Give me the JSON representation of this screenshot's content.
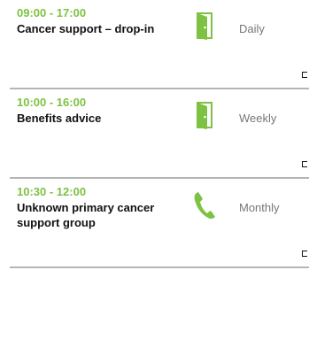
{
  "items": [
    {
      "time": "09:00 - 17:00",
      "title": "Cancer support – drop-in",
      "frequency": "Daily",
      "icon": "door-icon"
    },
    {
      "time": "10:00 - 16:00",
      "title": "Benefits advice",
      "frequency": "Weekly",
      "icon": "door-icon"
    },
    {
      "time": "10:30 - 12:00",
      "title": "Unknown primary cancer support group",
      "frequency": "Monthly",
      "icon": "phone-icon"
    }
  ],
  "colors": {
    "accent": "#7dc242",
    "text": "#111111",
    "muted": "#777777",
    "divider": "#b5b5b5"
  }
}
